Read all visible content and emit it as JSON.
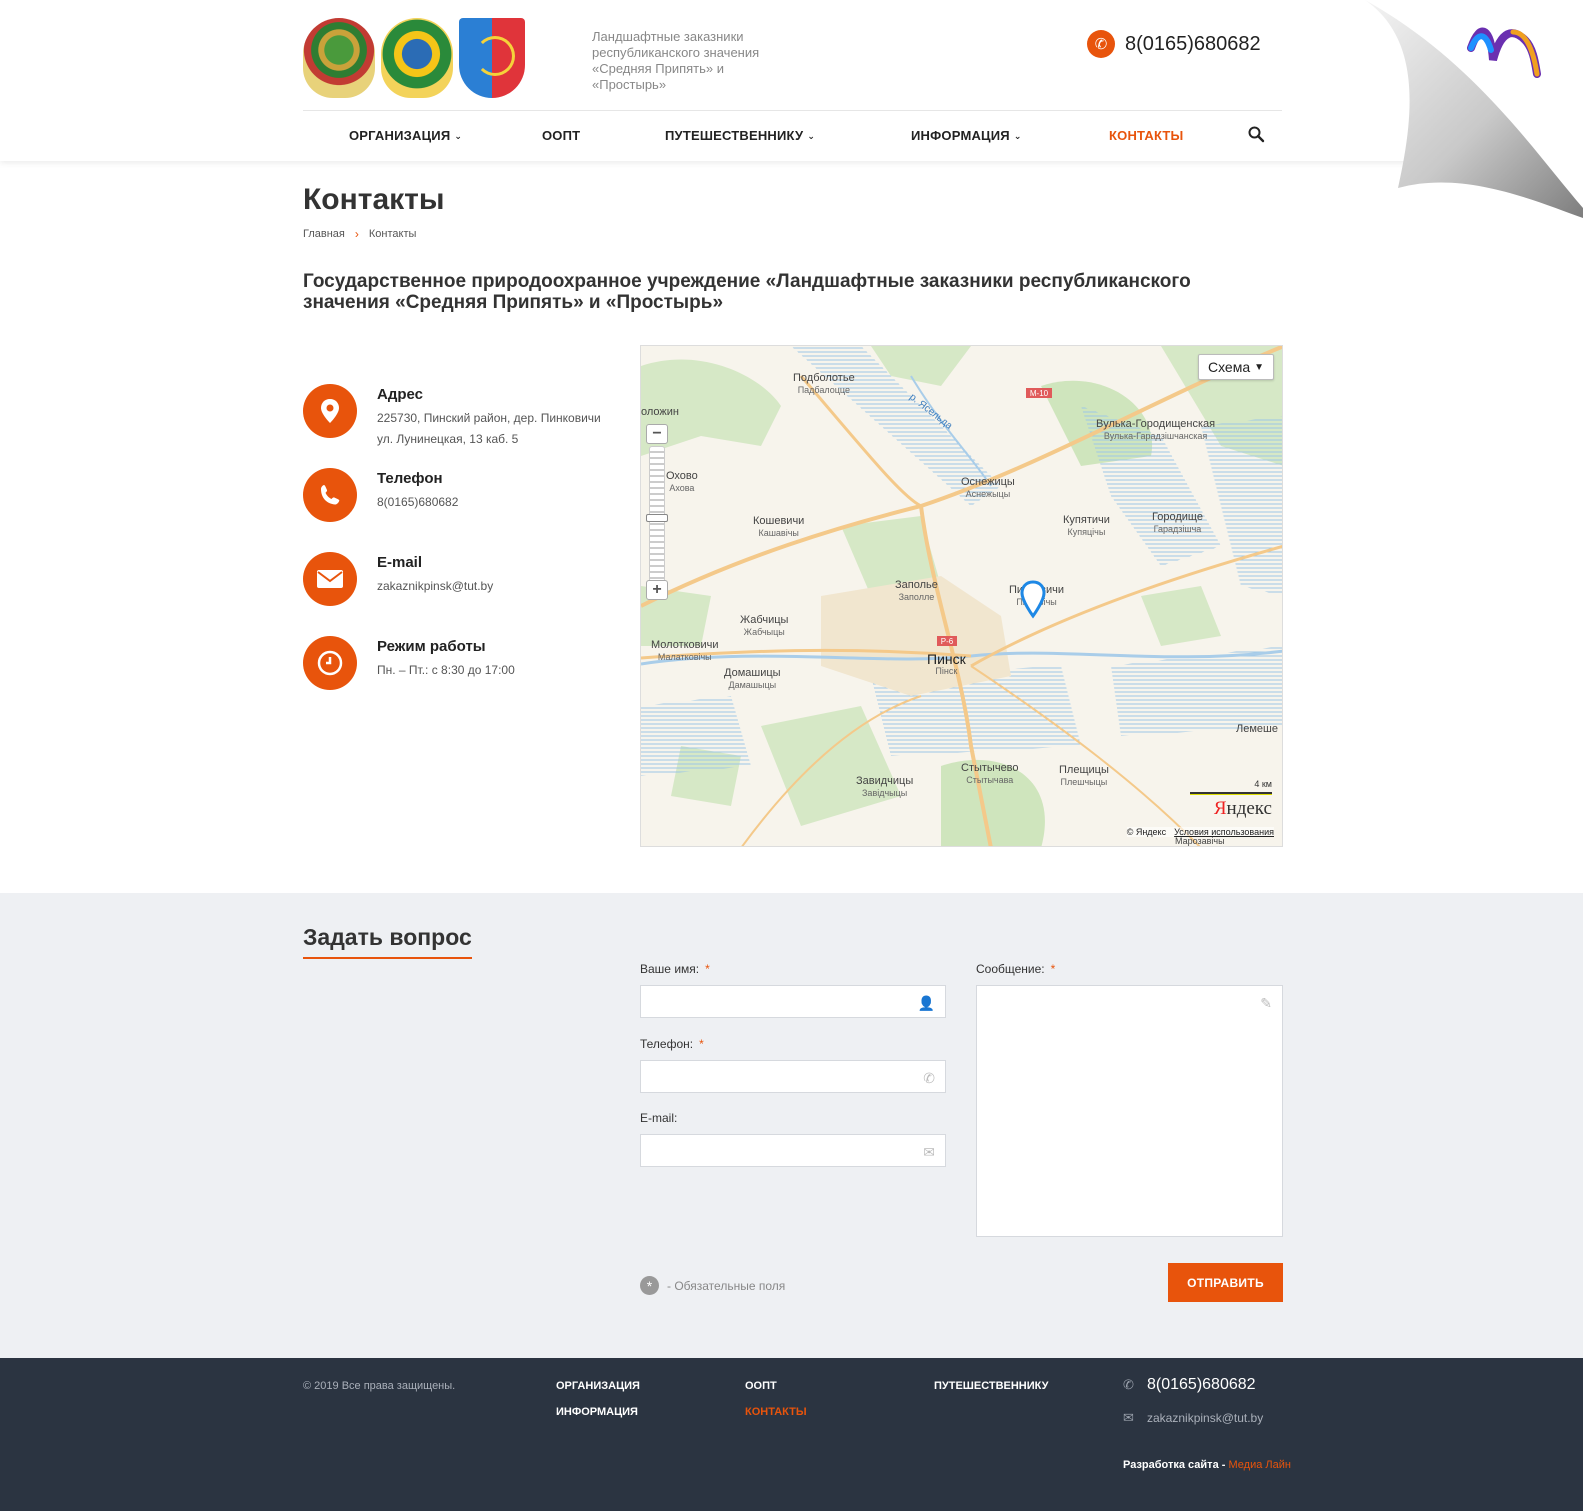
{
  "header": {
    "tagline": "Ландшафтные заказники республиканского значения «Средняя Припять» и «Простырь»",
    "phone": "8(0165)680682"
  },
  "nav": {
    "items": [
      {
        "label": "ОРГАНИЗАЦИЯ",
        "dropdown": true
      },
      {
        "label": "ООПТ",
        "dropdown": false
      },
      {
        "label": "ПУТЕШЕСТВЕННИКУ",
        "dropdown": true
      },
      {
        "label": "ИНФОРМАЦИЯ",
        "dropdown": true
      },
      {
        "label": "КОНТАКТЫ",
        "dropdown": false,
        "active": true
      }
    ]
  },
  "page": {
    "title": "Контакты",
    "breadcrumb": [
      "Главная",
      "Контакты"
    ],
    "org_title": "Государственное природоохранное учреждение «Ландшафтные заказники республиканского значения «Средняя Припять» и «Простырь»"
  },
  "contacts": [
    {
      "icon": "map-pin-icon",
      "label": "Адрес",
      "value": "225730, Пинский район, дер. Пинковичи ул. Лунинецкая, 13 каб. 5"
    },
    {
      "icon": "phone-icon",
      "label": "Телефон",
      "value": "8(0165)680682"
    },
    {
      "icon": "envelope-icon",
      "label": "E-mail",
      "value": "zakaznikpinsk@tut.by"
    },
    {
      "icon": "clock-icon",
      "label": "Режим работы",
      "value": "Пн. – Пт.: с 8:30 до 17:00"
    }
  ],
  "map": {
    "type_button": "Схема",
    "scale_label": "4 км",
    "provider": "Яндекс",
    "copyright": "© Яндекс",
    "terms": "Условия использования",
    "road_labels": [
      "M-10",
      "P-6"
    ],
    "river_label": "р. Ясельда",
    "places": [
      {
        "name": "Подболотье",
        "sub": "Падбалоцце"
      },
      {
        "name": "Вулька-Городищенская",
        "sub": "Вулька-Гарадзішчанская"
      },
      {
        "name": "Охово",
        "sub": "Ахова"
      },
      {
        "name": "Оснежицы",
        "sub": "Аснежыцы"
      },
      {
        "name": "Кошевичи",
        "sub": "Кашавічы"
      },
      {
        "name": "Купятичи",
        "sub": "Купяцічы"
      },
      {
        "name": "Городище",
        "sub": "Гарадзішча"
      },
      {
        "name": "Заполье",
        "sub": "Заполле"
      },
      {
        "name": "Пинковичи",
        "sub": "Пінковічы"
      },
      {
        "name": "Жабчицы",
        "sub": "Жабчыцы"
      },
      {
        "name": "Молотковичи",
        "sub": "Малатковічы"
      },
      {
        "name": "Пинск",
        "sub": "Пінск"
      },
      {
        "name": "Домашицы",
        "sub": "Дамашыцы"
      },
      {
        "name": "Лемеше",
        "sub": ""
      },
      {
        "name": "Стытычево",
        "sub": "Стытычава"
      },
      {
        "name": "Плещицы",
        "sub": "Плешчыцы"
      },
      {
        "name": "Завидчицы",
        "sub": "Завідчыцы"
      },
      {
        "name": "Марозавічы",
        "sub": ""
      },
      {
        "name": "оложин",
        "sub": ""
      }
    ]
  },
  "form": {
    "title": "Задать вопрос",
    "name_label": "Ваше имя:",
    "phone_label": "Телефон:",
    "email_label": "E-mail:",
    "message_label": "Сообщение:",
    "required_mark": "*",
    "required_note": "- Обязательные поля",
    "submit_label": "ОТПРАВИТЬ",
    "name_value": "",
    "phone_value": "",
    "email_value": "",
    "message_value": ""
  },
  "footer": {
    "copyright": "© 2019 Все права защищены.",
    "links": [
      "ОРГАНИЗАЦИЯ",
      "ИНФОРМАЦИЯ",
      "ООПТ",
      "КОНТАКТЫ",
      "ПУТЕШЕСТВЕННИКУ"
    ],
    "phone": "8(0165)680682",
    "email": "zakaznikpinsk@tut.by",
    "dev_label": "Разработка сайта -",
    "dev_studio": "Медиа Лайн"
  },
  "colors": {
    "accent": "#e8540c",
    "footer_bg": "#2b3441",
    "form_bg": "#eef0f3"
  }
}
